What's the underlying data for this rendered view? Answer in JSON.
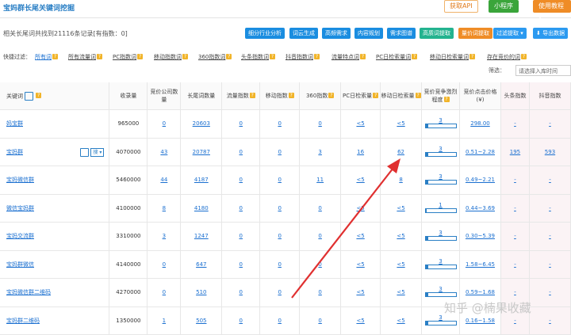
{
  "topbar": {
    "title_part1": "宝妈群",
    "title_part2": "长尾关键词挖掘",
    "btn_api": "获取API",
    "btn_mini": "小程序",
    "btn_tutorial": "使用教程 ▾"
  },
  "summary": {
    "prefix": "相关长尾词共找到",
    "count": "21116",
    "middle": "条记录[有指数：",
    "index_count": "0",
    "suffix": "]"
  },
  "actions": [
    "细分行业分析",
    "词云生成",
    "高频需求",
    "内容规划",
    "需求图谱",
    "高质词提取",
    "量价词提取",
    "过滤提取 ▾",
    "⬇ 导出数据"
  ],
  "filters": {
    "label": "快捷过滤：",
    "items": [
      "所有词",
      "所有流量词",
      "PC指数词",
      "移动指数词",
      "360指数词",
      "头条指数词",
      "抖音指数词",
      "流量特点词",
      "PC日检索量词",
      "移动日检索量词",
      "存在竞价的词"
    ]
  },
  "screen": {
    "label": "筛选：",
    "placeholder": "请选择入库时间"
  },
  "table": {
    "headers": [
      "关键词",
      "收录量",
      "竞价公司数量",
      "长尾词数量",
      "流量指数",
      "移动指数",
      "360指数",
      "PC日检索量",
      "移动日检索量",
      "竞价竞争激烈程度",
      "竞价点击价格(¥)",
      "头条指数",
      "抖音指数"
    ],
    "rows": [
      {
        "kw": "妈宝群",
        "shoulu": "965000",
        "jj": "0",
        "ct": "20603",
        "ll": "0",
        "yd": "0",
        "s360": "0",
        "pc": "<5",
        "mob": "<5",
        "comp": "3",
        "comp_frac": 0.1,
        "price": "298.00",
        "tt": "-",
        "dy": "-"
      },
      {
        "kw": "宝妈群",
        "shoulu": "4070000",
        "jj": "43",
        "ct": "20787",
        "ll": "0",
        "yd": "0",
        "s360": "3",
        "pc": "16",
        "mob": "62",
        "comp": "3",
        "comp_frac": 0.1,
        "price": "0.51~2.28",
        "tt": "195",
        "dy": "593"
      },
      {
        "kw": "宝妈微信群",
        "shoulu": "5460000",
        "jj": "44",
        "ct": "4187",
        "ll": "0",
        "yd": "0",
        "s360": "11",
        "pc": "<5",
        "mob": "8",
        "comp": "3",
        "comp_frac": 0.1,
        "price": "0.49~2.21",
        "tt": "-",
        "dy": "-"
      },
      {
        "kw": "微信宝妈群",
        "shoulu": "4100000",
        "jj": "8",
        "ct": "4180",
        "ll": "0",
        "yd": "0",
        "s360": "0",
        "pc": "<5",
        "mob": "<5",
        "comp": "1",
        "comp_frac": 0.05,
        "price": "0.44~3.69",
        "tt": "-",
        "dy": "-"
      },
      {
        "kw": "宝妈交流群",
        "shoulu": "3310000",
        "jj": "3",
        "ct": "1247",
        "ll": "0",
        "yd": "0",
        "s360": "0",
        "pc": "<5",
        "mob": "<5",
        "comp": "3",
        "comp_frac": 0.1,
        "price": "0.30~5.39",
        "tt": "-",
        "dy": "-"
      },
      {
        "kw": "宝妈群微信",
        "shoulu": "4140000",
        "jj": "0",
        "ct": "647",
        "ll": "0",
        "yd": "0",
        "s360": "0",
        "pc": "<5",
        "mob": "<5",
        "comp": "3",
        "comp_frac": 0.1,
        "price": "1.58~6.45",
        "tt": "-",
        "dy": "-"
      },
      {
        "kw": "宝妈微信群二维码",
        "shoulu": "4270000",
        "jj": "0",
        "ct": "510",
        "ll": "0",
        "yd": "0",
        "s360": "0",
        "pc": "<5",
        "mob": "<5",
        "comp": "3",
        "comp_frac": 0.1,
        "price": "0.59~1.68",
        "tt": "-",
        "dy": "-"
      },
      {
        "kw": "宝妈群二维码",
        "shoulu": "1350000",
        "jj": "1",
        "ct": "505",
        "ll": "0",
        "yd": "0",
        "s360": "0",
        "pc": "<5",
        "mob": "<5",
        "comp": "3",
        "comp_frac": 0.1,
        "price": "0.16~1.58",
        "tt": "-",
        "dy": "-"
      }
    ],
    "row_action_label": "搜 ▾"
  },
  "watermark": "知乎 @楠果收藏",
  "colors": {
    "accent": "#1a8de0",
    "link": "#1a6fd0",
    "annotation_arrow": "#e03030"
  }
}
